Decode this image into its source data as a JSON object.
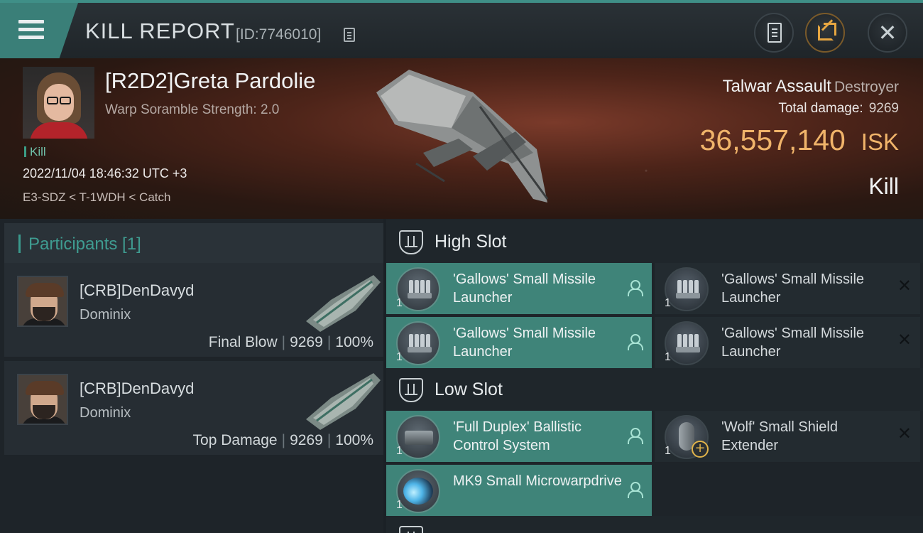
{
  "header": {
    "title": "KILL REPORT",
    "report_id": "[ID:7746010]"
  },
  "victim": {
    "name": "[R2D2]Greta Pardolie",
    "subtitle": "Warp Soramble Strength: 2.0",
    "tag": "Kill",
    "datetime": "2022/11/04 18:46:32 UTC +3",
    "location": "E3-SDZ < T-1WDH < Catch",
    "ship_name": "Talwar Assault",
    "ship_class": "Destroyer",
    "total_damage_label": "Total damage:",
    "total_damage": "9269",
    "isk_value": "36,557,140",
    "isk_unit": "ISK",
    "outcome": "Kill"
  },
  "participants": {
    "title": "Participants [1]",
    "rows": [
      {
        "name": "[CRB]DenDavyd",
        "ship": "Dominix",
        "role": "Final Blow",
        "damage": "9269",
        "percent": "100%"
      },
      {
        "name": "[CRB]DenDavyd",
        "ship": "Dominix",
        "role": "Top Damage",
        "damage": "9269",
        "percent": "100%"
      }
    ]
  },
  "fitting": {
    "high_label": "High Slot",
    "low_label": "Low Slot",
    "high": [
      {
        "name": "'Gallows' Small Missile Launcher",
        "qty": "1",
        "status": "dropped"
      },
      {
        "name": "'Gallows' Small Missile Launcher",
        "qty": "1",
        "status": "destroyed"
      },
      {
        "name": "'Gallows' Small Missile Launcher",
        "qty": "1",
        "status": "dropped"
      },
      {
        "name": "'Gallows' Small Missile Launcher",
        "qty": "1",
        "status": "destroyed"
      }
    ],
    "low": [
      {
        "name": "'Full Duplex' Ballistic Control System",
        "qty": "1",
        "status": "dropped"
      },
      {
        "name": "'Wolf' Small Shield Extender",
        "qty": "1",
        "status": "destroyed"
      },
      {
        "name": "MK9 Small Microwarpdrive",
        "qty": "1",
        "status": "dropped"
      }
    ]
  },
  "colors": {
    "accent": "#3f8479",
    "isk": "#f0b46a",
    "banner": "#4d2419"
  },
  "icons": {
    "menu": "hamburger-icon",
    "copy": "copy-icon",
    "clipboard": "clipboard-icon",
    "share": "share-icon",
    "close": "close-icon",
    "slot": "slot-icon",
    "dropped": "person-icon",
    "destroyed": "x-icon"
  }
}
